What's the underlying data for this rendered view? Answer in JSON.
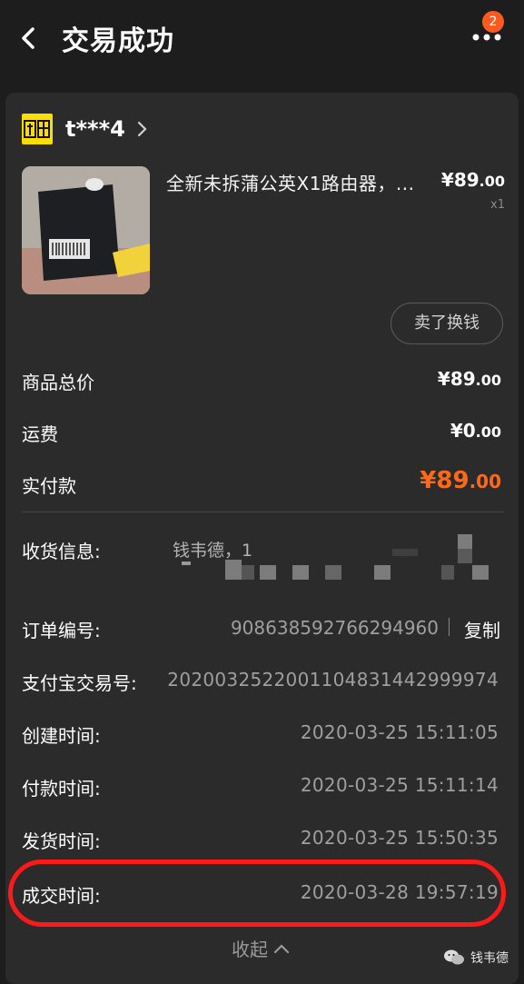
{
  "header": {
    "title": "交易成功",
    "badge_count": "2"
  },
  "seller": {
    "logo_text": "闲鱼",
    "name": "t***4"
  },
  "product": {
    "title": "全新未拆蒲公英X1路由器，...",
    "price_main": "¥89",
    "price_decimal": ".00",
    "quantity": "x1"
  },
  "actions": {
    "resell": "卖了换钱",
    "copy": "复制",
    "collapse": "收起"
  },
  "summary": {
    "goods_total_label": "商品总价",
    "goods_total_main": "¥89",
    "goods_total_decimal": ".00",
    "shipping_label": "运费",
    "shipping_main": "¥0",
    "shipping_decimal": ".00",
    "paid_label": "实付款",
    "paid_main": "¥89",
    "paid_decimal": ".00"
  },
  "details": {
    "address_label": "收货信息:",
    "address_value": "钱韦德，1",
    "order_no_label": "订单编号:",
    "order_no_value": "908638592766294960",
    "alipay_label": "支付宝交易号:",
    "alipay_value": "2020032522001104831442999974",
    "created_label": "创建时间:",
    "created_value": "2020-03-25 15:11:05",
    "paid_time_label": "付款时间:",
    "paid_time_value": "2020-03-25 15:11:14",
    "shipped_label": "发货时间:",
    "shipped_value": "2020-03-25 15:50:35",
    "closed_label": "成交时间:",
    "closed_value": "2020-03-28 19:57:19"
  },
  "watermark": {
    "text": "钱韦德"
  },
  "colors": {
    "accent_orange": "#ff6a1a",
    "highlight_red": "#ff1a1a",
    "logo_yellow": "#ffdd00"
  }
}
